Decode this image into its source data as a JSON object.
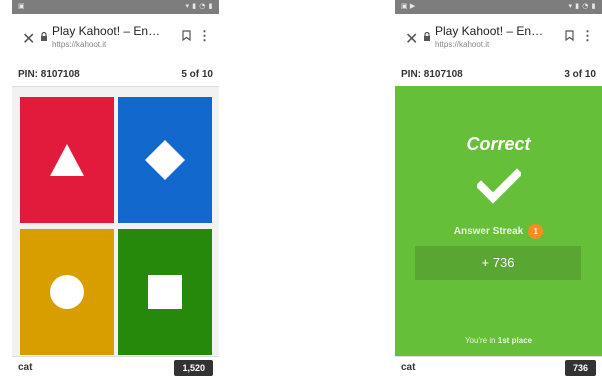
{
  "colors": {
    "red": "#e21b3c",
    "blue": "#1368ce",
    "yellow": "#d89e00",
    "green": "#26890c",
    "correct_bg": "#66bf39",
    "streak_badge": "#ff8b20",
    "score_badge": "#333333"
  },
  "left_screen": {
    "browser": {
      "title": "Play Kahoot! – En…",
      "url": "https://kahoot.it",
      "close_icon": "close-icon",
      "lock_icon": "lock-icon",
      "bookmark_icon": "bookmark-icon",
      "menu_icon": "more-vert-icon"
    },
    "pin": "PIN: 8107108",
    "question_counter": "5 of 10",
    "answers": [
      {
        "shape": "triangle",
        "color": "red"
      },
      {
        "shape": "diamond",
        "color": "blue"
      },
      {
        "shape": "circle",
        "color": "yellow"
      },
      {
        "shape": "square",
        "color": "green"
      }
    ],
    "player_name": "cat",
    "score": "1,520"
  },
  "right_screen": {
    "browser": {
      "title": "Play Kahoot! – En…",
      "url": "https://kahoot.it",
      "close_icon": "close-icon",
      "lock_icon": "lock-icon",
      "bookmark_icon": "bookmark-icon",
      "menu_icon": "more-vert-icon"
    },
    "pin": "PIN: 8107108",
    "question_counter": "3 of 10",
    "result_heading": "Correct",
    "check_icon": "checkmark-icon",
    "streak_label": "Answer Streak",
    "streak_count": "1",
    "points": "+ 736",
    "place_prefix": "You're in",
    "place": "1st place",
    "player_name": "cat",
    "score": "736"
  }
}
